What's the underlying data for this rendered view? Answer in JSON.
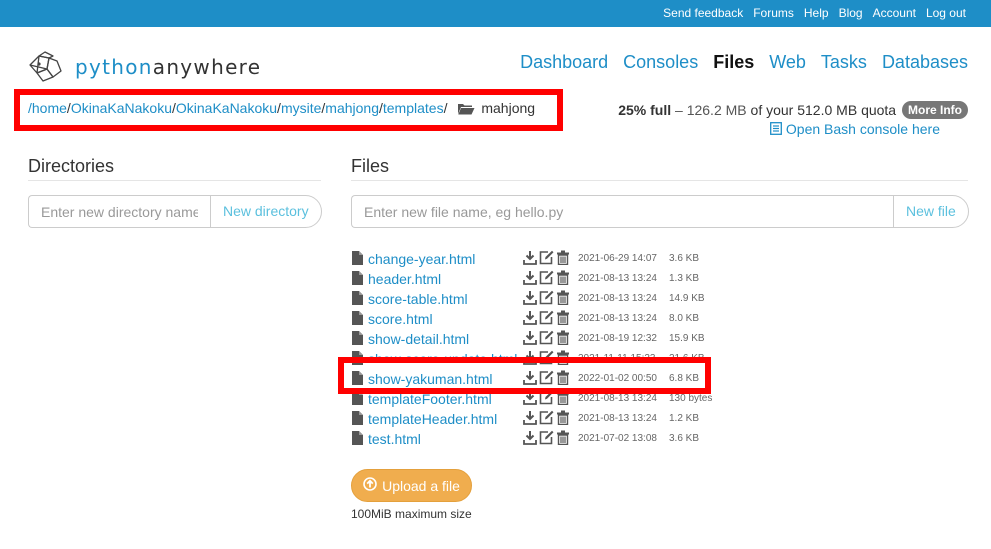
{
  "topbar": {
    "links": [
      "Send feedback",
      "Forums",
      "Help",
      "Blog",
      "Account",
      "Log out"
    ]
  },
  "logo": {
    "part1": "python",
    "part2": "anywhere"
  },
  "nav": {
    "items": [
      "Dashboard",
      "Consoles",
      "Files",
      "Web",
      "Tasks",
      "Databases"
    ],
    "active": "Files"
  },
  "breadcrumb": {
    "segments": [
      "/home",
      "OkinaKaNakoku",
      "OkinaKaNakoku",
      "mysite",
      "mahjong",
      "templates"
    ],
    "current": "mahjong"
  },
  "quota": {
    "percent": "25% full",
    "dash": "–",
    "used": "126.2 MB",
    "of_your": "of your",
    "total": "512.0 MB",
    "quota_word": "quota",
    "more_info": "More Info",
    "bash_link": "Open Bash console here"
  },
  "directories": {
    "heading": "Directories",
    "placeholder": "Enter new directory name",
    "button": "New directory"
  },
  "files": {
    "heading": "Files",
    "placeholder": "Enter new file name, eg hello.py",
    "button": "New file",
    "list": [
      {
        "name": "change-year.html",
        "date": "2021-06-29 14:07",
        "size": "3.6 KB"
      },
      {
        "name": "header.html",
        "date": "2021-08-13 13:24",
        "size": "1.3 KB"
      },
      {
        "name": "score-table.html",
        "date": "2021-08-13 13:24",
        "size": "14.9 KB"
      },
      {
        "name": "score.html",
        "date": "2021-08-13 13:24",
        "size": "8.0 KB"
      },
      {
        "name": "show-detail.html",
        "date": "2021-08-19 12:32",
        "size": "15.9 KB"
      },
      {
        "name": "show-score-update.html",
        "date": "2021-11-11 15:23",
        "size": "21.6 KB"
      },
      {
        "name": "show-yakuman.html",
        "date": "2022-01-02 00:50",
        "size": "6.8 KB"
      },
      {
        "name": "templateFooter.html",
        "date": "2021-08-13 13:24",
        "size": "130 bytes"
      },
      {
        "name": "templateHeader.html",
        "date": "2021-08-13 13:24",
        "size": "1.2 KB"
      },
      {
        "name": "test.html",
        "date": "2021-07-02 13:08",
        "size": "3.6 KB"
      }
    ]
  },
  "upload": {
    "button": "Upload a file",
    "note": "100MiB maximum size"
  },
  "colors": {
    "brand": "#1e8ec7",
    "highlight": "#ff0000",
    "upload": "#f0ad4e",
    "new_button_text": "#5bc0de"
  }
}
